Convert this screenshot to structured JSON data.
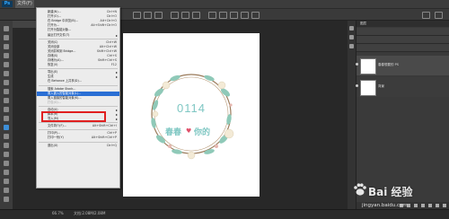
{
  "app": {
    "logo_text": "Ps",
    "menu_active": "文件(F)"
  },
  "file_menu": {
    "items": [
      {
        "label": "新建(N)...",
        "shortcut": "Ctrl+N",
        "disabled": false
      },
      {
        "label": "打开(O)...",
        "shortcut": "Ctrl+O",
        "disabled": false
      },
      {
        "label": "在 Bridge 中浏览(B)...",
        "shortcut": "Alt+Ctrl+O",
        "disabled": false
      },
      {
        "label": "打开为...",
        "shortcut": "Alt+Shift+Ctrl+O",
        "disabled": false
      },
      {
        "label": "打开为智能对象...",
        "shortcut": "",
        "disabled": false
      },
      {
        "label": "最近打开文件(T)",
        "shortcut": "",
        "submenu": true,
        "disabled": false
      },
      {
        "sep": true
      },
      {
        "label": "关闭(C)",
        "shortcut": "Ctrl+W",
        "disabled": false
      },
      {
        "label": "关闭全部",
        "shortcut": "Alt+Ctrl+W",
        "disabled": false
      },
      {
        "label": "关闭并转到 Bridge...",
        "shortcut": "Shift+Ctrl+W",
        "disabled": false
      },
      {
        "label": "存储(S)",
        "shortcut": "Ctrl+S",
        "disabled": false
      },
      {
        "label": "存储为(A)...",
        "shortcut": "Shift+Ctrl+S",
        "disabled": false
      },
      {
        "label": "恢复(V)",
        "shortcut": "F12",
        "disabled": false
      },
      {
        "sep": true
      },
      {
        "label": "导出(E)",
        "shortcut": "",
        "submenu": true,
        "disabled": false
      },
      {
        "label": "生成",
        "shortcut": "",
        "submenu": true,
        "disabled": false
      },
      {
        "label": "在 Behance 上共享(D)...",
        "shortcut": "",
        "disabled": false
      },
      {
        "sep": true
      },
      {
        "label": "搜索 Adobe Stock...",
        "shortcut": "",
        "disabled": false
      },
      {
        "label": "置入嵌入的智能对象(L)...",
        "shortcut": "",
        "disabled": false,
        "highlight": true
      },
      {
        "label": "置入链接的智能对象(K)...",
        "shortcut": "",
        "disabled": false
      },
      {
        "label": "打包(G)...",
        "shortcut": "",
        "disabled": true
      },
      {
        "sep": true
      },
      {
        "label": "自动(U)",
        "shortcut": "",
        "submenu": true,
        "disabled": false
      },
      {
        "label": "脚本(R)",
        "shortcut": "",
        "submenu": true,
        "disabled": false
      },
      {
        "label": "导入(M)",
        "shortcut": "",
        "submenu": true,
        "disabled": false
      },
      {
        "sep": true
      },
      {
        "label": "文件简介(F)...",
        "shortcut": "Alt+Shift+Ctrl+I",
        "disabled": false
      },
      {
        "sep": true
      },
      {
        "label": "打印(P)...",
        "shortcut": "Ctrl+P",
        "disabled": false
      },
      {
        "label": "打印一份(Y)",
        "shortcut": "Alt+Shift+Ctrl+P",
        "disabled": false
      },
      {
        "sep": true
      },
      {
        "label": "退出(X)",
        "shortcut": "Ctrl+Q",
        "disabled": false
      }
    ]
  },
  "artwork": {
    "number": "0114",
    "caption_left": "春春",
    "caption_right": "你的",
    "text_color": "#7fc7c3",
    "heart_color": "#e0506a"
  },
  "layers_panel": {
    "header": "图层",
    "layer1_name": "春春想要的 PS",
    "layer2_name": "背景"
  },
  "status": {
    "zoom": "66.7%",
    "doc": "文档:2.08M/2.08M"
  },
  "watermark": {
    "brand": "Bai 经验",
    "url": "jingyan.baidu.com"
  }
}
